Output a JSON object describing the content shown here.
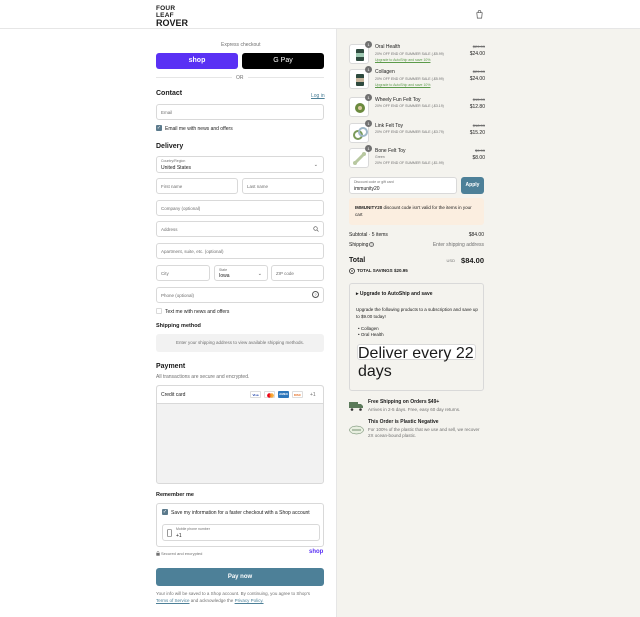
{
  "brand": {
    "line1": "FOUR LEAF",
    "line2": "ROVER"
  },
  "express": {
    "label": "Express checkout",
    "shop_label": "shop",
    "gpay_label": "G Pay",
    "or_label": "OR"
  },
  "contact": {
    "heading": "Contact",
    "login_label": "Log in",
    "email_placeholder": "Email",
    "news_label": "Email me with news and offers"
  },
  "delivery": {
    "heading": "Delivery",
    "country_label": "Country/Region",
    "country_value": "United States",
    "first_name": "First name",
    "last_name": "Last name",
    "company": "Company (optional)",
    "address": "Address",
    "apartment": "Apartment, suite, etc. (optional)",
    "city": "City",
    "state_label": "State",
    "state_value": "Iowa",
    "zip": "ZIP code",
    "phone": "Phone (optional)",
    "text_offers": "Text me with news and offers"
  },
  "shipping_method": {
    "heading": "Shipping method",
    "note": "Enter your shipping address to view available shipping methods."
  },
  "payment": {
    "heading": "Payment",
    "subtext": "All transactions are secure and encrypted.",
    "credit_card_label": "Credit card",
    "card_brands": [
      "Visa",
      "MC",
      "AMEX",
      "DISC"
    ],
    "more_label": "+1"
  },
  "remember": {
    "heading": "Remember me",
    "save_label": "Save my information for a faster checkout with a Shop account",
    "phone_label": "Mobile phone number",
    "phone_value": "+1",
    "secure_label": "Secured and encrypted",
    "shop_label": "shop"
  },
  "pay_now": "Pay now",
  "legal": {
    "line1": "Your info will be saved to a Shop account. By continuing, you agree to Shop's",
    "terms": "Terms of Service",
    "and": "and acknowledge the",
    "privacy": "Privacy Policy."
  },
  "cart": {
    "items": [
      {
        "qty": "1",
        "name": "Oral Health",
        "discount": "20% OFF END OF SUMMER SALE (-$5.99)",
        "link": "Upgrade to AutoShip and save 10%",
        "old_price": "$29.99",
        "price": "$24.00"
      },
      {
        "qty": "1",
        "name": "Collagen",
        "discount": "20% OFF END OF SUMMER SALE (-$5.99)",
        "link": "Upgrade to AutoShip and save 10%",
        "old_price": "$29.99",
        "price": "$24.00"
      },
      {
        "qty": "1",
        "name": "Wheely Fun Felt Toy",
        "discount": "20% OFF END OF SUMMER SALE (-$3.19)",
        "link": "",
        "old_price": "$15.99",
        "price": "$12.80"
      },
      {
        "qty": "1",
        "name": "Link Felt Toy",
        "discount": "20% OFF END OF SUMMER SALE (-$3.79)",
        "link": "",
        "old_price": "$18.99",
        "price": "$15.20"
      },
      {
        "qty": "1",
        "name": "Bone Felt Toy",
        "variant": "Green",
        "discount": "20% OFF END OF SUMMER SALE (-$1.99)",
        "link": "",
        "old_price": "$9.99",
        "price": "$8.00"
      }
    ],
    "discount_label": "Discount code or gift card",
    "discount_value": "immunity20",
    "apply_label": "Apply",
    "warning_code": "IMMUNITY20",
    "warning_text": "discount code isn't valid for the items in your cart",
    "subtotal_label": "Subtotal · 5 items",
    "subtotal_value": "$84.00",
    "shipping_label": "Shipping",
    "shipping_value": "Enter shipping address",
    "total_label": "Total",
    "currency": "USD",
    "total_value": "$84.00",
    "savings_label": "TOTAL SAVINGS",
    "savings_value": "$20.95"
  },
  "autoship": {
    "title": "Upgrade to AutoShip and save",
    "body": "Upgrade the following products to a subscription and save up to $9.00 today!",
    "products": [
      "Collagen",
      "Oral Health"
    ],
    "deliver_label": "Deliver every",
    "deliver_value": "22 days"
  },
  "perks": [
    {
      "title": "Free Shipping on Orders $49+",
      "body": "Arrives in 2-5 days. Free, easy 60 day returns."
    },
    {
      "title": "This Order is Plastic Negative",
      "body": "For 100% of the plastic that we use and sell, we recover 2X ocean-bound plastic."
    }
  ],
  "colors": {
    "accent": "#4d8098",
    "shop": "#5a31f4",
    "panel": "#f4f3ee",
    "warn": "#fbeee0"
  }
}
